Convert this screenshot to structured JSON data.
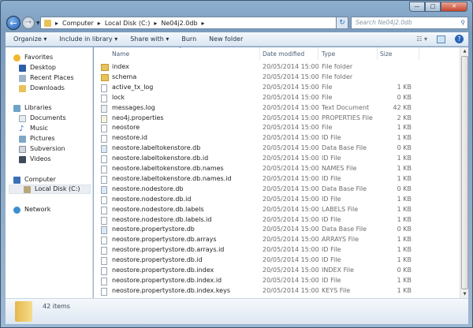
{
  "window": {
    "controls": [
      "minimize",
      "maximize",
      "close"
    ]
  },
  "address": {
    "crumbs": [
      "Computer",
      "Local Disk (C:)",
      "Ne04j2.0db"
    ],
    "search_placeholder": "Search Ne04j2.0db"
  },
  "toolbar": {
    "organize": "Organize ▾",
    "include": "Include in library ▾",
    "share": "Share with ▾",
    "burn": "Burn",
    "new_folder": "New folder"
  },
  "sidebar": {
    "favorites": "Favorites",
    "desktop": "Desktop",
    "recent": "Recent Places",
    "downloads": "Downloads",
    "libraries": "Libraries",
    "documents": "Documents",
    "music": "Music",
    "pictures": "Pictures",
    "subversion": "Subversion",
    "videos": "Videos",
    "computer": "Computer",
    "local_disk": "Local Disk (C:)",
    "network": "Network"
  },
  "columns": {
    "name": "Name",
    "date": "Date modified",
    "type": "Type",
    "size": "Size"
  },
  "files": [
    {
      "icon": "folder",
      "name": "index",
      "date": "20/05/2014 15:00",
      "type": "File folder",
      "size": ""
    },
    {
      "icon": "folder",
      "name": "schema",
      "date": "20/05/2014 15:00",
      "type": "File folder",
      "size": ""
    },
    {
      "icon": "file",
      "name": "active_tx_log",
      "date": "20/05/2014 15:00",
      "type": "File",
      "size": "1 KB"
    },
    {
      "icon": "file",
      "name": "lock",
      "date": "20/05/2014 15:00",
      "type": "File",
      "size": "0 KB"
    },
    {
      "icon": "text",
      "name": "messages.log",
      "date": "20/05/2014 15:00",
      "type": "Text Document",
      "size": "42 KB"
    },
    {
      "icon": "props",
      "name": "neo4j.properties",
      "date": "20/05/2014 15:00",
      "type": "PROPERTIES File",
      "size": "2 KB"
    },
    {
      "icon": "file",
      "name": "neostore",
      "date": "20/05/2014 15:00",
      "type": "File",
      "size": "1 KB"
    },
    {
      "icon": "file",
      "name": "neostore.id",
      "date": "20/05/2014 15:00",
      "type": "ID File",
      "size": "1 KB"
    },
    {
      "icon": "db",
      "name": "neostore.labeltokenstore.db",
      "date": "20/05/2014 15:00",
      "type": "Data Base File",
      "size": "0 KB"
    },
    {
      "icon": "file",
      "name": "neostore.labeltokenstore.db.id",
      "date": "20/05/2014 15:00",
      "type": "ID File",
      "size": "1 KB"
    },
    {
      "icon": "file",
      "name": "neostore.labeltokenstore.db.names",
      "date": "20/05/2014 15:00",
      "type": "NAMES File",
      "size": "1 KB"
    },
    {
      "icon": "file",
      "name": "neostore.labeltokenstore.db.names.id",
      "date": "20/05/2014 15:00",
      "type": "ID File",
      "size": "1 KB"
    },
    {
      "icon": "db",
      "name": "neostore.nodestore.db",
      "date": "20/05/2014 15:00",
      "type": "Data Base File",
      "size": "0 KB"
    },
    {
      "icon": "file",
      "name": "neostore.nodestore.db.id",
      "date": "20/05/2014 15:00",
      "type": "ID File",
      "size": "1 KB"
    },
    {
      "icon": "file",
      "name": "neostore.nodestore.db.labels",
      "date": "20/05/2014 15:00",
      "type": "LABELS File",
      "size": "1 KB"
    },
    {
      "icon": "file",
      "name": "neostore.nodestore.db.labels.id",
      "date": "20/05/2014 15:00",
      "type": "ID File",
      "size": "1 KB"
    },
    {
      "icon": "db",
      "name": "neostore.propertystore.db",
      "date": "20/05/2014 15:00",
      "type": "Data Base File",
      "size": "0 KB"
    },
    {
      "icon": "file",
      "name": "neostore.propertystore.db.arrays",
      "date": "20/05/2014 15:00",
      "type": "ARRAYS File",
      "size": "1 KB"
    },
    {
      "icon": "file",
      "name": "neostore.propertystore.db.arrays.id",
      "date": "20/05/2014 15:00",
      "type": "ID File",
      "size": "1 KB"
    },
    {
      "icon": "file",
      "name": "neostore.propertystore.db.id",
      "date": "20/05/2014 15:00",
      "type": "ID File",
      "size": "1 KB"
    },
    {
      "icon": "file",
      "name": "neostore.propertystore.db.index",
      "date": "20/05/2014 15:00",
      "type": "INDEX File",
      "size": "0 KB"
    },
    {
      "icon": "file",
      "name": "neostore.propertystore.db.index.id",
      "date": "20/05/2014 15:00",
      "type": "ID File",
      "size": "1 KB"
    },
    {
      "icon": "file",
      "name": "neostore.propertystore.db.index.keys",
      "date": "20/05/2014 15:00",
      "type": "KEYS File",
      "size": "1 KB"
    }
  ],
  "status": {
    "count": "42 items"
  }
}
